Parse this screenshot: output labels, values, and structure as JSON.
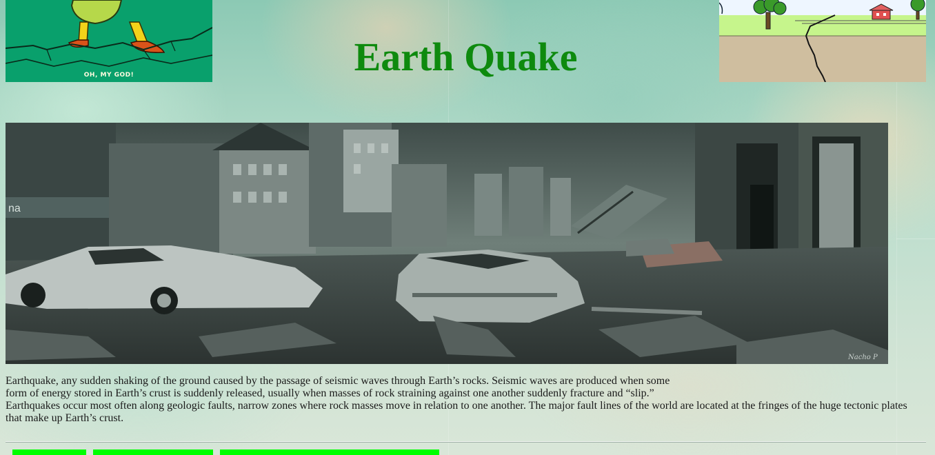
{
  "page": {
    "title": "Earth Quake"
  },
  "images": {
    "left_corner": {
      "icon": "cartoon-walking-on-cracked-ground",
      "caption": "OH, MY GOD!"
    },
    "right_corner": {
      "icon": "cartoon-fault-line-landscape"
    },
    "hero": {
      "icon": "destroyed-city-street-photo",
      "sign_text": "na",
      "signature": "Nacho P"
    }
  },
  "description": {
    "line1": "Earthquake, any sudden shaking of the ground caused by the passage of seismic waves through Earth’s rocks. Seismic waves are produced when some",
    "line2": "form of energy stored in Earth’s crust is suddenly released, usually when masses of rock straining against one another suddenly fracture and “slip.”",
    "line3": "Earthquakes occur most often along geologic faults, narrow zones where rock masses move in relation to one another. The major fault lines of the world are located at the fringes of the huge tectonic plates that make up Earth’s crust."
  },
  "nav": {
    "buttons": [
      "",
      "",
      ""
    ]
  },
  "colors": {
    "title": "#0e8a0e",
    "nav_button": "#00ff00",
    "text": "#1a1a1a"
  }
}
